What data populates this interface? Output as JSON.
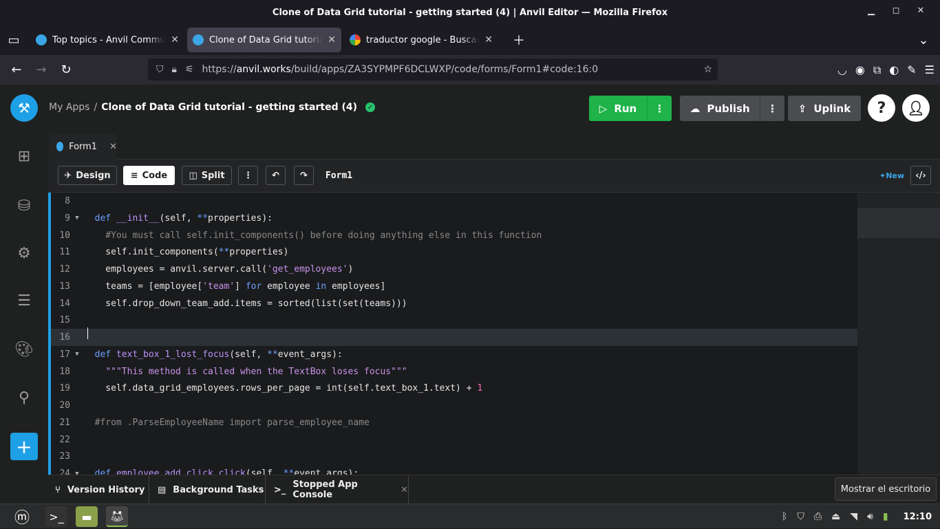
{
  "window": {
    "title": "Clone of Data Grid tutorial - getting started (4) | Anvil Editor — Mozilla Firefox"
  },
  "tabs": [
    {
      "label": "Top topics - Anvil Community Forum",
      "active": false
    },
    {
      "label": "Clone of Data Grid tutorial - getting started",
      "active": true
    },
    {
      "label": "traductor google - Buscar con Google",
      "active": false
    }
  ],
  "nav": {
    "url_prefix": "https://",
    "url_host": "anvil.works",
    "url_path": "/build/apps/ZA3SYPMPF6DCLWXP/code/forms/Form1#code:16:0"
  },
  "anvil": {
    "breadcrumb_root": "My Apps",
    "breadcrumb_sep": "/",
    "app_name": "Clone of Data Grid tutorial - getting started (4)",
    "run_label": "Run",
    "publish_label": "Publish",
    "uplink_label": "Uplink",
    "help_label": "?"
  },
  "editor": {
    "file_tab": "Form1",
    "design_label": "Design",
    "code_label": "Code",
    "split_label": "Split",
    "form_name": "Form1",
    "new_label": "New",
    "lines": [
      {
        "n": "8",
        "fold": "",
        "text": ""
      },
      {
        "n": "9",
        "fold": "▼",
        "text": "  def __init__(self, **properties):"
      },
      {
        "n": "10",
        "fold": "",
        "text": "    #You must call self.init_components() before doing anything else in this function"
      },
      {
        "n": "11",
        "fold": "",
        "text": "    self.init_components(**properties)"
      },
      {
        "n": "12",
        "fold": "",
        "text": "    employees = anvil.server.call('get_employees')"
      },
      {
        "n": "13",
        "fold": "",
        "text": "    teams = [employee['team'] for employee in employees]"
      },
      {
        "n": "14",
        "fold": "",
        "text": "    self.drop_down_team_add.items = sorted(list(set(teams)))"
      },
      {
        "n": "15",
        "fold": "",
        "text": ""
      },
      {
        "n": "16",
        "fold": "",
        "text": ""
      },
      {
        "n": "17",
        "fold": "▼",
        "text": "  def text_box_1_lost_focus(self, **event_args):"
      },
      {
        "n": "18",
        "fold": "",
        "text": "    \"\"\"This method is called when the TextBox loses focus\"\"\""
      },
      {
        "n": "19",
        "fold": "",
        "text": "    self.data_grid_employees.rows_per_page = int(self.text_box_1.text) + 1"
      },
      {
        "n": "20",
        "fold": "",
        "text": ""
      },
      {
        "n": "21",
        "fold": "",
        "text": "  #from .ParseEmployeeName import parse_employee_name"
      },
      {
        "n": "22",
        "fold": "",
        "text": ""
      },
      {
        "n": "23",
        "fold": "",
        "text": ""
      },
      {
        "n": "24",
        "fold": "▼",
        "text": "  def employee_add_click_click(self, **event_args):"
      }
    ]
  },
  "bottom": {
    "version_history": "Version History",
    "background_tasks": "Background Tasks",
    "app_console": "Stopped App Console",
    "tooltip": "Mostrar el escritorio"
  },
  "taskbar": {
    "clock": "12:10"
  },
  "colors": {
    "accent": "#1ea0e6",
    "run_green": "#1fb34a"
  }
}
